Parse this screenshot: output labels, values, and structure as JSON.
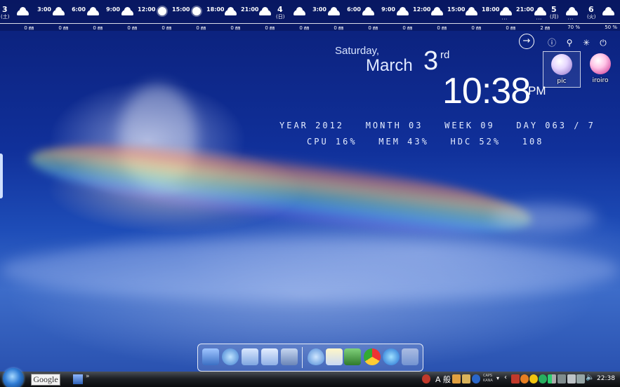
{
  "weather": {
    "day1": {
      "date": "3",
      "weekday": "(土)"
    },
    "day2": {
      "date": "4",
      "weekday": "(日)"
    },
    "slots": [
      {
        "time": "",
        "icon": "cloud",
        "precip": "0 ㎜"
      },
      {
        "time": "3:00",
        "icon": "cloud",
        "precip": "0 ㎜"
      },
      {
        "time": "6:00",
        "icon": "cloud",
        "precip": "0 ㎜"
      },
      {
        "time": "9:00",
        "icon": "cloud",
        "precip": "0 ㎜"
      },
      {
        "time": "12:00",
        "icon": "sun",
        "precip": "0 ㎜"
      },
      {
        "time": "15:00",
        "icon": "sun",
        "precip": "0 ㎜"
      },
      {
        "time": "18:00",
        "icon": "cloud",
        "precip": "0 ㎜"
      },
      {
        "time": "21:00",
        "icon": "cloud",
        "precip": "0 ㎜"
      },
      {
        "time": "",
        "icon": "cloud",
        "precip": "0 ㎜"
      },
      {
        "time": "3:00",
        "icon": "cloud",
        "precip": "0 ㎜"
      },
      {
        "time": "6:00",
        "icon": "cloud",
        "precip": "0 ㎜"
      },
      {
        "time": "9:00",
        "icon": "cloud",
        "precip": "0 ㎜"
      },
      {
        "time": "12:00",
        "icon": "cloud",
        "precip": "0 ㎜"
      },
      {
        "time": "15:00",
        "icon": "cloud",
        "precip": "0 ㎜"
      },
      {
        "time": "18:00",
        "icon": "cloud-rain",
        "precip": "0 ㎜"
      },
      {
        "time": "21:00",
        "icon": "cloud-rain",
        "precip": "2 ㎜"
      }
    ],
    "day3": {
      "date": "5",
      "weekday": "(月)",
      "icon": "cloud-rain",
      "precip": "70 %"
    },
    "day4": {
      "date": "6",
      "weekday": "(火)",
      "icon": "cloud",
      "precip": "50 %"
    }
  },
  "clock": {
    "weekday": "Saturday,",
    "month": "March",
    "date": "3",
    "suffix": "rd",
    "time": "10:38",
    "ampm": "PM"
  },
  "stats": {
    "line1": "YEAR 2012   MONTH 03   WEEK 09   DAY 063 / 7",
    "line2": "CPU 16%   MEM 43%   HDC 52%   108"
  },
  "controls": {
    "arrow_icon": "arrow-right-circle-icon",
    "info_icon": "info-icon",
    "settings_icon": "wrench-icon",
    "loading_icon": "spinner-icon",
    "power_icon": "power-icon"
  },
  "desktop_icons": [
    {
      "label": "pic",
      "selected": true
    },
    {
      "label": "iroiro",
      "selected": false
    }
  ],
  "dock": {
    "items": [
      "computer-icon",
      "network-icon",
      "folder-icon",
      "documents-folder-icon",
      "tools-icon",
      "water-drop-icon",
      "notepad-icon",
      "evernote-icon",
      "chrome-icon",
      "itunes-icon",
      "recycle-bin-icon"
    ]
  },
  "taskbar": {
    "search_label": "Google",
    "ime_mode": "A 般",
    "caps": "CAPS",
    "kana": "KANA",
    "time": "22:38"
  },
  "colors": {
    "sky_dark": "#0b1f78",
    "sky_mid": "#1e4db8",
    "taskbar": "#1d2025"
  }
}
